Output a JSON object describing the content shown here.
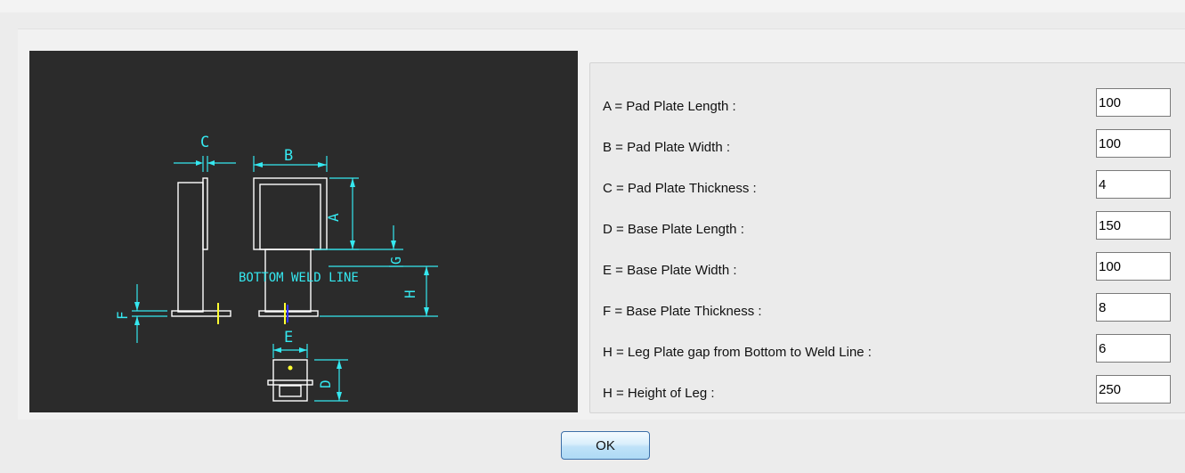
{
  "drawing": {
    "labels": {
      "a": "A",
      "b": "B",
      "c": "C",
      "d": "D",
      "e": "E",
      "f": "F",
      "g": "G",
      "h": "H",
      "weld_line": "BOTTOM WELD LINE"
    }
  },
  "params": [
    {
      "label": "A = Pad Plate Length :",
      "value": "100"
    },
    {
      "label": "B = Pad Plate Width :",
      "value": "100"
    },
    {
      "label": "C = Pad Plate Thickness :",
      "value": "4"
    },
    {
      "label": "D = Base Plate Length :",
      "value": "150"
    },
    {
      "label": "E = Base Plate Width :",
      "value": "100"
    },
    {
      "label": "F = Base Plate Thickness :",
      "value": "8"
    },
    {
      "label": "H = Leg Plate gap from Bottom to Weld Line :",
      "value": "6"
    },
    {
      "label": "H = Height of Leg :",
      "value": "250"
    }
  ],
  "ok_label": "OK",
  "colors": {
    "drawing_bg": "#2b2b2b",
    "dimension": "#35e8f0",
    "outline": "#ffffff",
    "weld_mark": "#ffff33"
  }
}
